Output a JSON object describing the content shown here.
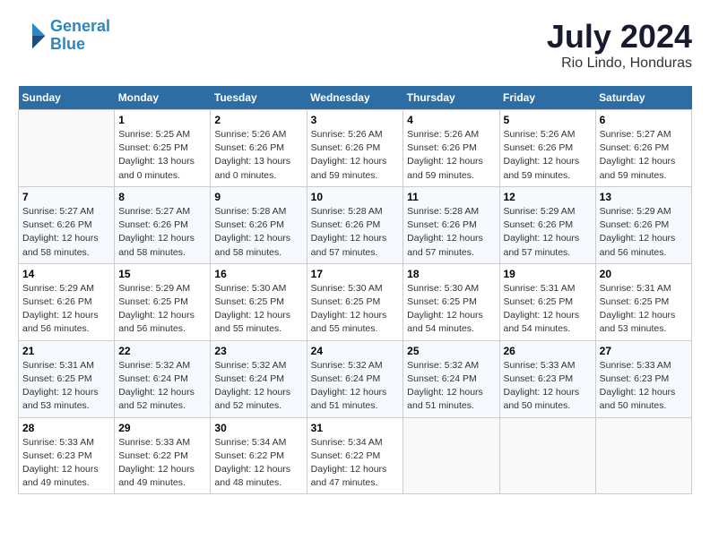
{
  "header": {
    "logo_line1": "General",
    "logo_line2": "Blue",
    "title": "July 2024",
    "subtitle": "Rio Lindo, Honduras"
  },
  "calendar": {
    "headers": [
      "Sunday",
      "Monday",
      "Tuesday",
      "Wednesday",
      "Thursday",
      "Friday",
      "Saturday"
    ],
    "weeks": [
      [
        {
          "num": "",
          "info": ""
        },
        {
          "num": "1",
          "info": "Sunrise: 5:25 AM\nSunset: 6:25 PM\nDaylight: 13 hours\nand 0 minutes."
        },
        {
          "num": "2",
          "info": "Sunrise: 5:26 AM\nSunset: 6:26 PM\nDaylight: 13 hours\nand 0 minutes."
        },
        {
          "num": "3",
          "info": "Sunrise: 5:26 AM\nSunset: 6:26 PM\nDaylight: 12 hours\nand 59 minutes."
        },
        {
          "num": "4",
          "info": "Sunrise: 5:26 AM\nSunset: 6:26 PM\nDaylight: 12 hours\nand 59 minutes."
        },
        {
          "num": "5",
          "info": "Sunrise: 5:26 AM\nSunset: 6:26 PM\nDaylight: 12 hours\nand 59 minutes."
        },
        {
          "num": "6",
          "info": "Sunrise: 5:27 AM\nSunset: 6:26 PM\nDaylight: 12 hours\nand 59 minutes."
        }
      ],
      [
        {
          "num": "7",
          "info": "Sunrise: 5:27 AM\nSunset: 6:26 PM\nDaylight: 12 hours\nand 58 minutes."
        },
        {
          "num": "8",
          "info": "Sunrise: 5:27 AM\nSunset: 6:26 PM\nDaylight: 12 hours\nand 58 minutes."
        },
        {
          "num": "9",
          "info": "Sunrise: 5:28 AM\nSunset: 6:26 PM\nDaylight: 12 hours\nand 58 minutes."
        },
        {
          "num": "10",
          "info": "Sunrise: 5:28 AM\nSunset: 6:26 PM\nDaylight: 12 hours\nand 57 minutes."
        },
        {
          "num": "11",
          "info": "Sunrise: 5:28 AM\nSunset: 6:26 PM\nDaylight: 12 hours\nand 57 minutes."
        },
        {
          "num": "12",
          "info": "Sunrise: 5:29 AM\nSunset: 6:26 PM\nDaylight: 12 hours\nand 57 minutes."
        },
        {
          "num": "13",
          "info": "Sunrise: 5:29 AM\nSunset: 6:26 PM\nDaylight: 12 hours\nand 56 minutes."
        }
      ],
      [
        {
          "num": "14",
          "info": "Sunrise: 5:29 AM\nSunset: 6:26 PM\nDaylight: 12 hours\nand 56 minutes."
        },
        {
          "num": "15",
          "info": "Sunrise: 5:29 AM\nSunset: 6:25 PM\nDaylight: 12 hours\nand 56 minutes."
        },
        {
          "num": "16",
          "info": "Sunrise: 5:30 AM\nSunset: 6:25 PM\nDaylight: 12 hours\nand 55 minutes."
        },
        {
          "num": "17",
          "info": "Sunrise: 5:30 AM\nSunset: 6:25 PM\nDaylight: 12 hours\nand 55 minutes."
        },
        {
          "num": "18",
          "info": "Sunrise: 5:30 AM\nSunset: 6:25 PM\nDaylight: 12 hours\nand 54 minutes."
        },
        {
          "num": "19",
          "info": "Sunrise: 5:31 AM\nSunset: 6:25 PM\nDaylight: 12 hours\nand 54 minutes."
        },
        {
          "num": "20",
          "info": "Sunrise: 5:31 AM\nSunset: 6:25 PM\nDaylight: 12 hours\nand 53 minutes."
        }
      ],
      [
        {
          "num": "21",
          "info": "Sunrise: 5:31 AM\nSunset: 6:25 PM\nDaylight: 12 hours\nand 53 minutes."
        },
        {
          "num": "22",
          "info": "Sunrise: 5:32 AM\nSunset: 6:24 PM\nDaylight: 12 hours\nand 52 minutes."
        },
        {
          "num": "23",
          "info": "Sunrise: 5:32 AM\nSunset: 6:24 PM\nDaylight: 12 hours\nand 52 minutes."
        },
        {
          "num": "24",
          "info": "Sunrise: 5:32 AM\nSunset: 6:24 PM\nDaylight: 12 hours\nand 51 minutes."
        },
        {
          "num": "25",
          "info": "Sunrise: 5:32 AM\nSunset: 6:24 PM\nDaylight: 12 hours\nand 51 minutes."
        },
        {
          "num": "26",
          "info": "Sunrise: 5:33 AM\nSunset: 6:23 PM\nDaylight: 12 hours\nand 50 minutes."
        },
        {
          "num": "27",
          "info": "Sunrise: 5:33 AM\nSunset: 6:23 PM\nDaylight: 12 hours\nand 50 minutes."
        }
      ],
      [
        {
          "num": "28",
          "info": "Sunrise: 5:33 AM\nSunset: 6:23 PM\nDaylight: 12 hours\nand 49 minutes."
        },
        {
          "num": "29",
          "info": "Sunrise: 5:33 AM\nSunset: 6:22 PM\nDaylight: 12 hours\nand 49 minutes."
        },
        {
          "num": "30",
          "info": "Sunrise: 5:34 AM\nSunset: 6:22 PM\nDaylight: 12 hours\nand 48 minutes."
        },
        {
          "num": "31",
          "info": "Sunrise: 5:34 AM\nSunset: 6:22 PM\nDaylight: 12 hours\nand 47 minutes."
        },
        {
          "num": "",
          "info": ""
        },
        {
          "num": "",
          "info": ""
        },
        {
          "num": "",
          "info": ""
        }
      ]
    ]
  }
}
